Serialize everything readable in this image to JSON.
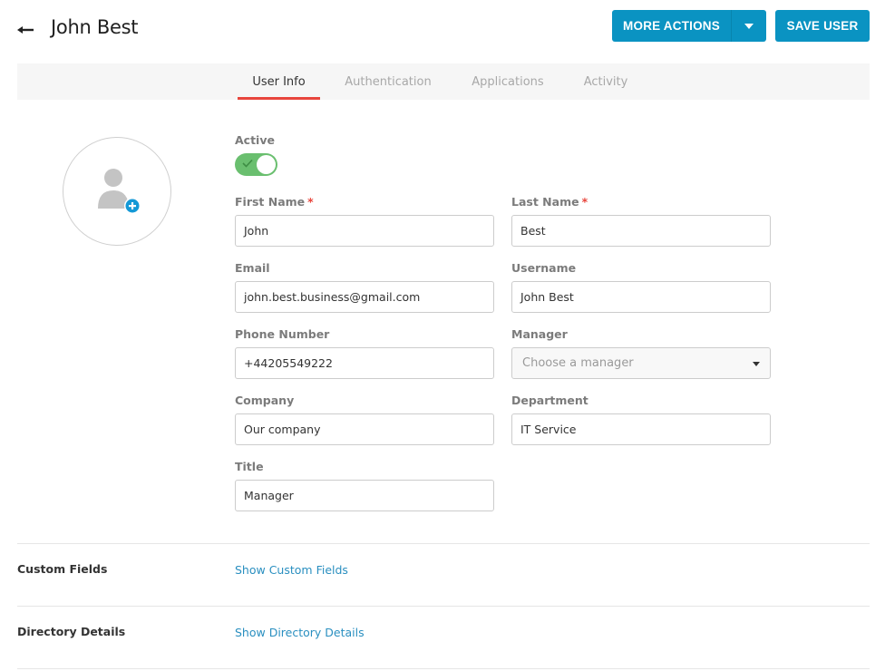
{
  "header": {
    "title": "John Best",
    "back_icon": "arrow-left-icon",
    "more_actions_label": "MORE ACTIONS",
    "save_label": "SAVE USER"
  },
  "tabs": [
    {
      "label": "User Info",
      "active": true
    },
    {
      "label": "Authentication",
      "active": false
    },
    {
      "label": "Applications",
      "active": false
    },
    {
      "label": "Activity",
      "active": false
    }
  ],
  "avatar": {
    "icon": "user-add-photo-icon"
  },
  "form": {
    "active_label": "Active",
    "active_value": true,
    "first_name": {
      "label": "First Name",
      "required": "*",
      "value": "John"
    },
    "last_name": {
      "label": "Last Name",
      "required": "*",
      "value": "Best"
    },
    "email": {
      "label": "Email",
      "value": "john.best.business@gmail.com"
    },
    "username": {
      "label": "Username",
      "value": "John Best"
    },
    "phone": {
      "label": "Phone Number",
      "value": "+44205549222"
    },
    "manager": {
      "label": "Manager",
      "placeholder": "Choose a manager"
    },
    "company": {
      "label": "Company",
      "value": "Our company"
    },
    "department": {
      "label": "Department",
      "value": "IT Service"
    },
    "title": {
      "label": "Title",
      "value": "Manager"
    }
  },
  "sections": [
    {
      "label": "Custom Fields",
      "link": "Show Custom Fields"
    },
    {
      "label": "Directory Details",
      "link": "Show Directory Details"
    }
  ],
  "colors": {
    "primary": "#0a93c2",
    "tab_active_underline": "#e8453c",
    "toggle_on": "#6abf6f",
    "link": "#2a8fc0"
  }
}
